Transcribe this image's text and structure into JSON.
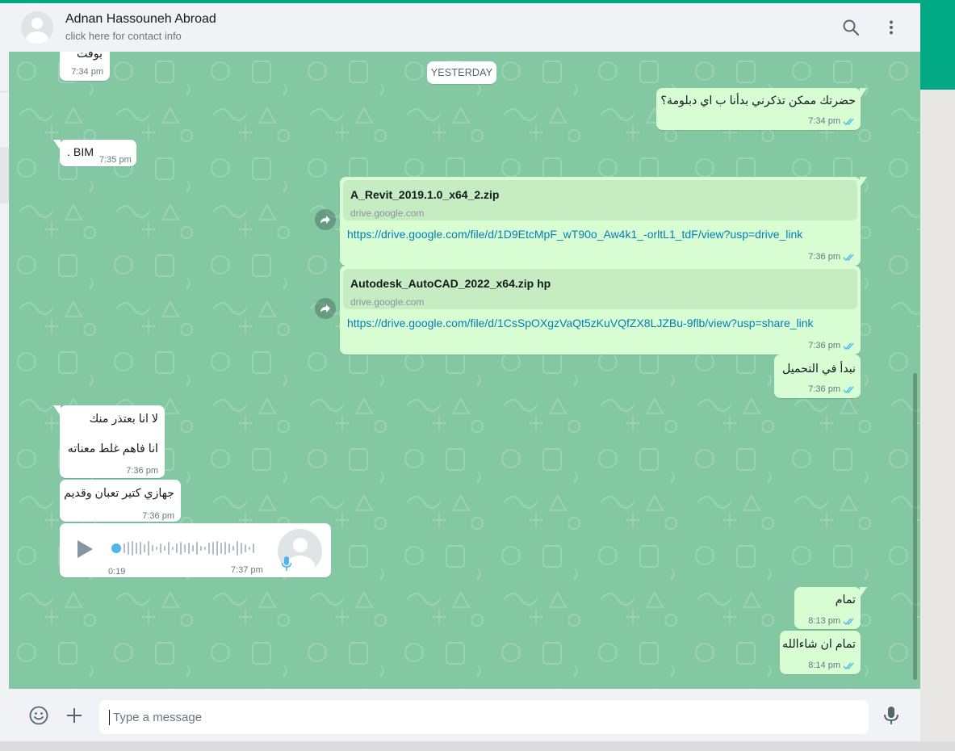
{
  "header": {
    "contact_name": "Adnan Hassouneh Abroad",
    "contact_subtitle": "click here for contact info",
    "icons": [
      "search-icon",
      "menu-dots-icon"
    ]
  },
  "chat": {
    "day_separator": "YESTERDAY",
    "messages": [
      {
        "direction": "in",
        "text": "بوقت",
        "time": "7:34 pm"
      },
      {
        "direction": "out",
        "text": "حضرتك ممكن تذكرني بدأنا ب اي دبلومة؟",
        "time": "7:34 pm",
        "status": "read"
      },
      {
        "direction": "in",
        "text": "BIM .",
        "time": "7:35 pm"
      },
      {
        "direction": "out",
        "type": "link",
        "forwarded": true,
        "link_title": "A_Revit_2019.1.0_x64_2.zip",
        "link_domain": "drive.google.com",
        "url": "https://drive.google.com/file/d/1D9EtcMpF_wT90o_Aw4k1_-orltL1_tdF/view?usp=drive_link",
        "time": "7:36 pm",
        "status": "read"
      },
      {
        "direction": "out",
        "type": "link",
        "forwarded": true,
        "link_title": "Autodesk_AutoCAD_2022_x64.zip hp",
        "link_domain": "drive.google.com",
        "url": "https://drive.google.com/file/d/1CsSpOXgzVaQt5zKuVQfZX8LJZBu-9flb/view?usp=share_link",
        "time": "7:36 pm",
        "status": "read"
      },
      {
        "direction": "out",
        "text": "نبدأ في التحميل",
        "time": "7:36 pm",
        "status": "read"
      },
      {
        "direction": "in",
        "line1": "لا انا بعتذر منك",
        "line2": "انا فاهم غلط معناته",
        "time": "7:36 pm"
      },
      {
        "direction": "in",
        "text": "جهازي كتير تعبان وقديم",
        "time": "7:36 pm"
      },
      {
        "direction": "in",
        "type": "voice",
        "duration": "0:19",
        "time": "7:37 pm"
      },
      {
        "direction": "out",
        "text": "تمام",
        "time": "8:13 pm",
        "status": "read"
      },
      {
        "direction": "out",
        "text": "تمام ان شاءالله",
        "time": "8:14 pm",
        "status": "read"
      }
    ]
  },
  "footer": {
    "placeholder": "Type a message",
    "icons": [
      "emoji-icon",
      "plus-icon",
      "microphone-icon"
    ]
  },
  "colors": {
    "brand_green": "#00a884",
    "chat_background": "#84c8a3",
    "outgoing_bubble": "#d9fdd3",
    "incoming_bubble": "#ffffff",
    "link_preview": "#c6ecc1",
    "read_ticks": "#53bdeb",
    "link_color": "#027eb5"
  }
}
